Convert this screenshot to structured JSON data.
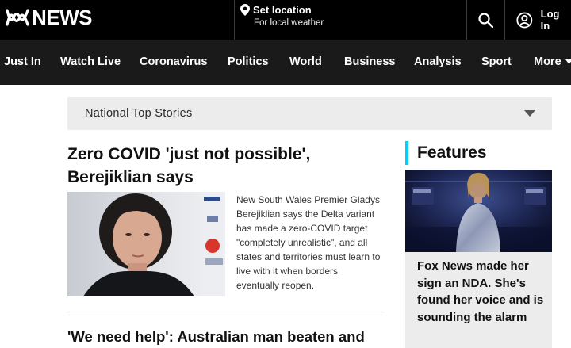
{
  "header": {
    "logo_text": "NEWS",
    "location_title": "Set location",
    "location_subtitle": "For local weather",
    "login_label": "Log In"
  },
  "nav": {
    "items": [
      {
        "label": "Just In"
      },
      {
        "label": "Watch Live"
      },
      {
        "label": "Coronavirus"
      },
      {
        "label": "Politics"
      },
      {
        "label": "World"
      },
      {
        "label": "Business"
      },
      {
        "label": "Analysis"
      },
      {
        "label": "Sport"
      },
      {
        "label": "More"
      }
    ]
  },
  "section_select": {
    "selected": "National Top Stories"
  },
  "lead_story": {
    "title": "Zero COVID 'just not possible', Berejiklian says",
    "summary": "New South Wales Premier Gladys Berejiklian says the Delta variant has made a zero-COVID target \"completely unrealistic\", and all states and territories must learn to live with it when borders eventually reopen."
  },
  "second_story": {
    "title": "'We need help': Australian man beaten and"
  },
  "features": {
    "heading": "Features",
    "card_title": "Fox News made her sign an NDA. She's found her voice and is sounding the alarm"
  },
  "colors": {
    "header_bg": "#000000",
    "nav_bg": "#1a1a1a",
    "accent": "#00cfff",
    "panel_bg": "#ececec"
  }
}
